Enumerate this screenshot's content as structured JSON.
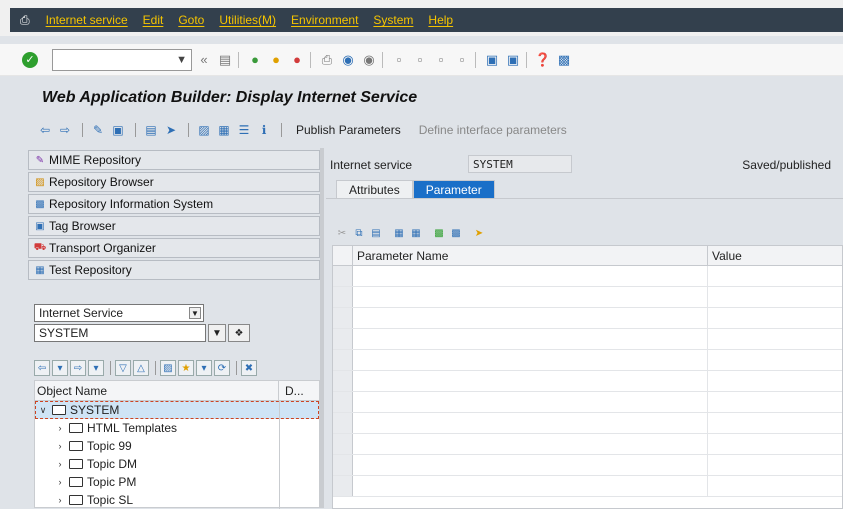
{
  "menu": {
    "items": [
      "Internet service",
      "Edit",
      "Goto",
      "Utilities(M)",
      "Environment",
      "System",
      "Help"
    ]
  },
  "toolbar": {
    "command_field_value": "",
    "back_symbol": "«"
  },
  "title": "Web Application Builder: Display Internet Service",
  "app_toolbar": {
    "publish_label": "Publish Parameters",
    "define_label": "Define interface parameters"
  },
  "left": {
    "nav": [
      {
        "label": "MIME Repository",
        "icon": "mime-icon"
      },
      {
        "label": "Repository Browser",
        "icon": "hierarchy-icon"
      },
      {
        "label": "Repository Information System",
        "icon": "info-system-icon"
      },
      {
        "label": "Tag Browser",
        "icon": "tag-icon"
      },
      {
        "label": "Transport Organizer",
        "icon": "truck-icon"
      },
      {
        "label": "Test Repository",
        "icon": "test-icon"
      }
    ],
    "object_type": "Internet Service",
    "object_name": "SYSTEM",
    "tree_header": {
      "col1": "Object Name",
      "col2": "D..."
    },
    "tree": [
      {
        "label": "SYSTEM",
        "expanded": true,
        "level": 0,
        "selected": true
      },
      {
        "label": "HTML Templates",
        "expanded": false,
        "level": 1
      },
      {
        "label": "Topic 99",
        "expanded": false,
        "level": 1
      },
      {
        "label": "Topic DM",
        "expanded": false,
        "level": 1
      },
      {
        "label": "Topic PM",
        "expanded": false,
        "level": 1
      },
      {
        "label": "Topic SL",
        "expanded": false,
        "level": 1
      }
    ]
  },
  "right": {
    "service_label": "Internet service",
    "service_value": "SYSTEM",
    "status": "Saved/published",
    "tabs": [
      {
        "label": "Attributes",
        "active": false
      },
      {
        "label": "Parameter",
        "active": true
      }
    ],
    "grid_header": {
      "col1": "Parameter Name",
      "col2": "Value"
    }
  },
  "colors": {
    "menubar": "#33404d",
    "menu_text": "#f5c400",
    "active_tab": "#1a6fc8",
    "selection": "#cfe4f5"
  }
}
